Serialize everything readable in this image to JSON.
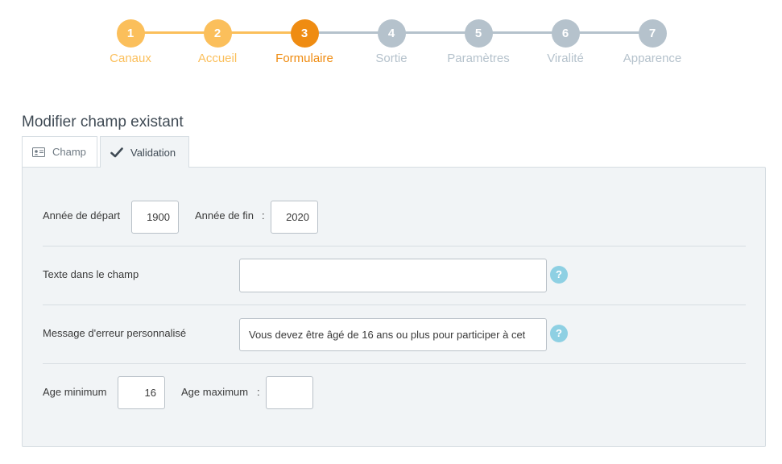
{
  "stepper": {
    "steps": [
      {
        "number": "1",
        "label": "Canaux",
        "state": "done"
      },
      {
        "number": "2",
        "label": "Accueil",
        "state": "done"
      },
      {
        "number": "3",
        "label": "Formulaire",
        "state": "active"
      },
      {
        "number": "4",
        "label": "Sortie",
        "state": "todo"
      },
      {
        "number": "5",
        "label": "Paramètres",
        "state": "todo"
      },
      {
        "number": "6",
        "label": "Viralité",
        "state": "todo"
      },
      {
        "number": "7",
        "label": "Apparence",
        "state": "todo"
      }
    ],
    "colors": {
      "done": "#fbbf5b",
      "active": "#ef8c12",
      "todo": "#b5c2cc"
    }
  },
  "page_title": "Modifier champ existant",
  "tabs": {
    "champ": {
      "label": "Champ",
      "icon": "id-card-icon"
    },
    "validation": {
      "label": "Validation",
      "icon": "checkmark-icon"
    }
  },
  "form": {
    "start_year": {
      "label": "Année de départ",
      "value": "1900"
    },
    "end_year": {
      "label": "Année de fin",
      "separator": ":",
      "value": "2020"
    },
    "placeholder_text": {
      "label": "Texte dans le champ",
      "value": "",
      "help": "?"
    },
    "error_message": {
      "label": "Message d'erreur personnalisé",
      "value": "Vous devez être âgé de 16 ans ou plus pour participer à cet",
      "help": "?"
    },
    "age_min": {
      "label": "Age minimum",
      "value": "16"
    },
    "age_max": {
      "label": "Age maximum",
      "separator": ":",
      "value": ""
    }
  }
}
